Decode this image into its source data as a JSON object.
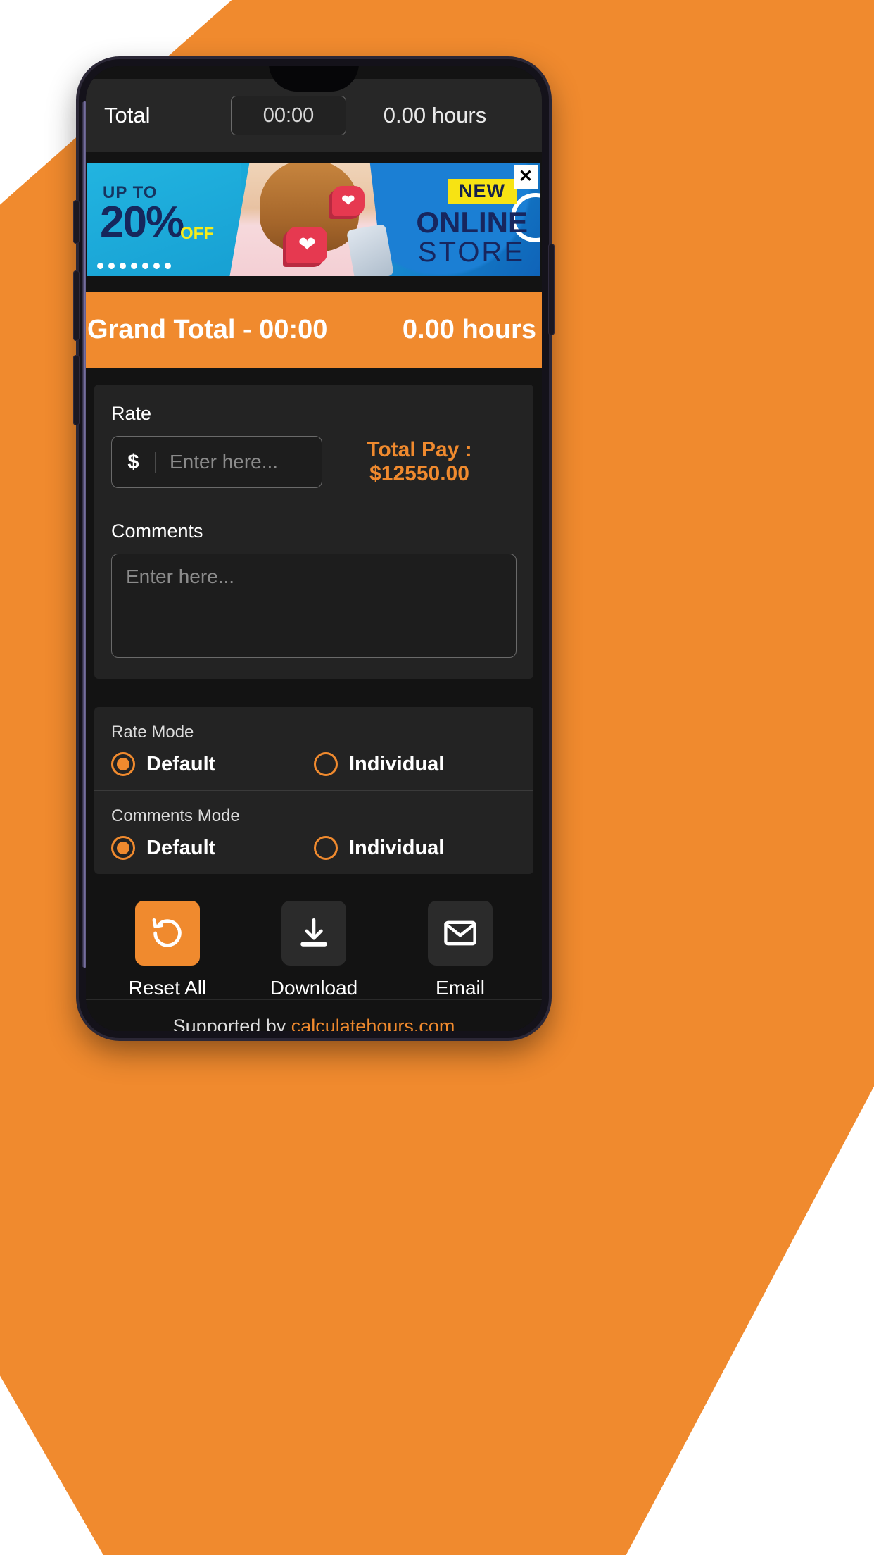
{
  "app": {
    "total_row": {
      "label": "Total",
      "time": "00:00",
      "hours": "0.00 hours"
    },
    "ad": {
      "upto": "UP TO",
      "percent": "20%",
      "off": "OFF",
      "new": "NEW",
      "online": "ONLINE",
      "store": "STORE",
      "close_icon": "close-icon"
    },
    "grand_total": {
      "left": "Grand Total - 00:00",
      "right": "0.00 hours"
    },
    "rate": {
      "label": "Rate",
      "currency": "$",
      "value": "",
      "placeholder": "Enter here...",
      "total_pay": "Total Pay : $12550.00"
    },
    "comments": {
      "label": "Comments",
      "value": "",
      "placeholder": "Enter here..."
    },
    "rate_mode": {
      "title": "Rate Mode",
      "options": [
        {
          "label": "Default",
          "selected": true
        },
        {
          "label": "Individual",
          "selected": false
        }
      ]
    },
    "comments_mode": {
      "title": "Comments Mode",
      "options": [
        {
          "label": "Default",
          "selected": true
        },
        {
          "label": "Individual",
          "selected": false
        }
      ]
    },
    "actions": [
      {
        "label": "Reset All",
        "icon": "reset-icon",
        "primary": true
      },
      {
        "label": "Download",
        "icon": "download-icon",
        "primary": false
      },
      {
        "label": "Email",
        "icon": "envelope-icon",
        "primary": false
      }
    ],
    "footer": {
      "prefix": "Supported by ",
      "link": "calculatehours.com"
    }
  },
  "colors": {
    "accent": "#F08A2E",
    "surface": "#232323",
    "background": "#131313"
  }
}
